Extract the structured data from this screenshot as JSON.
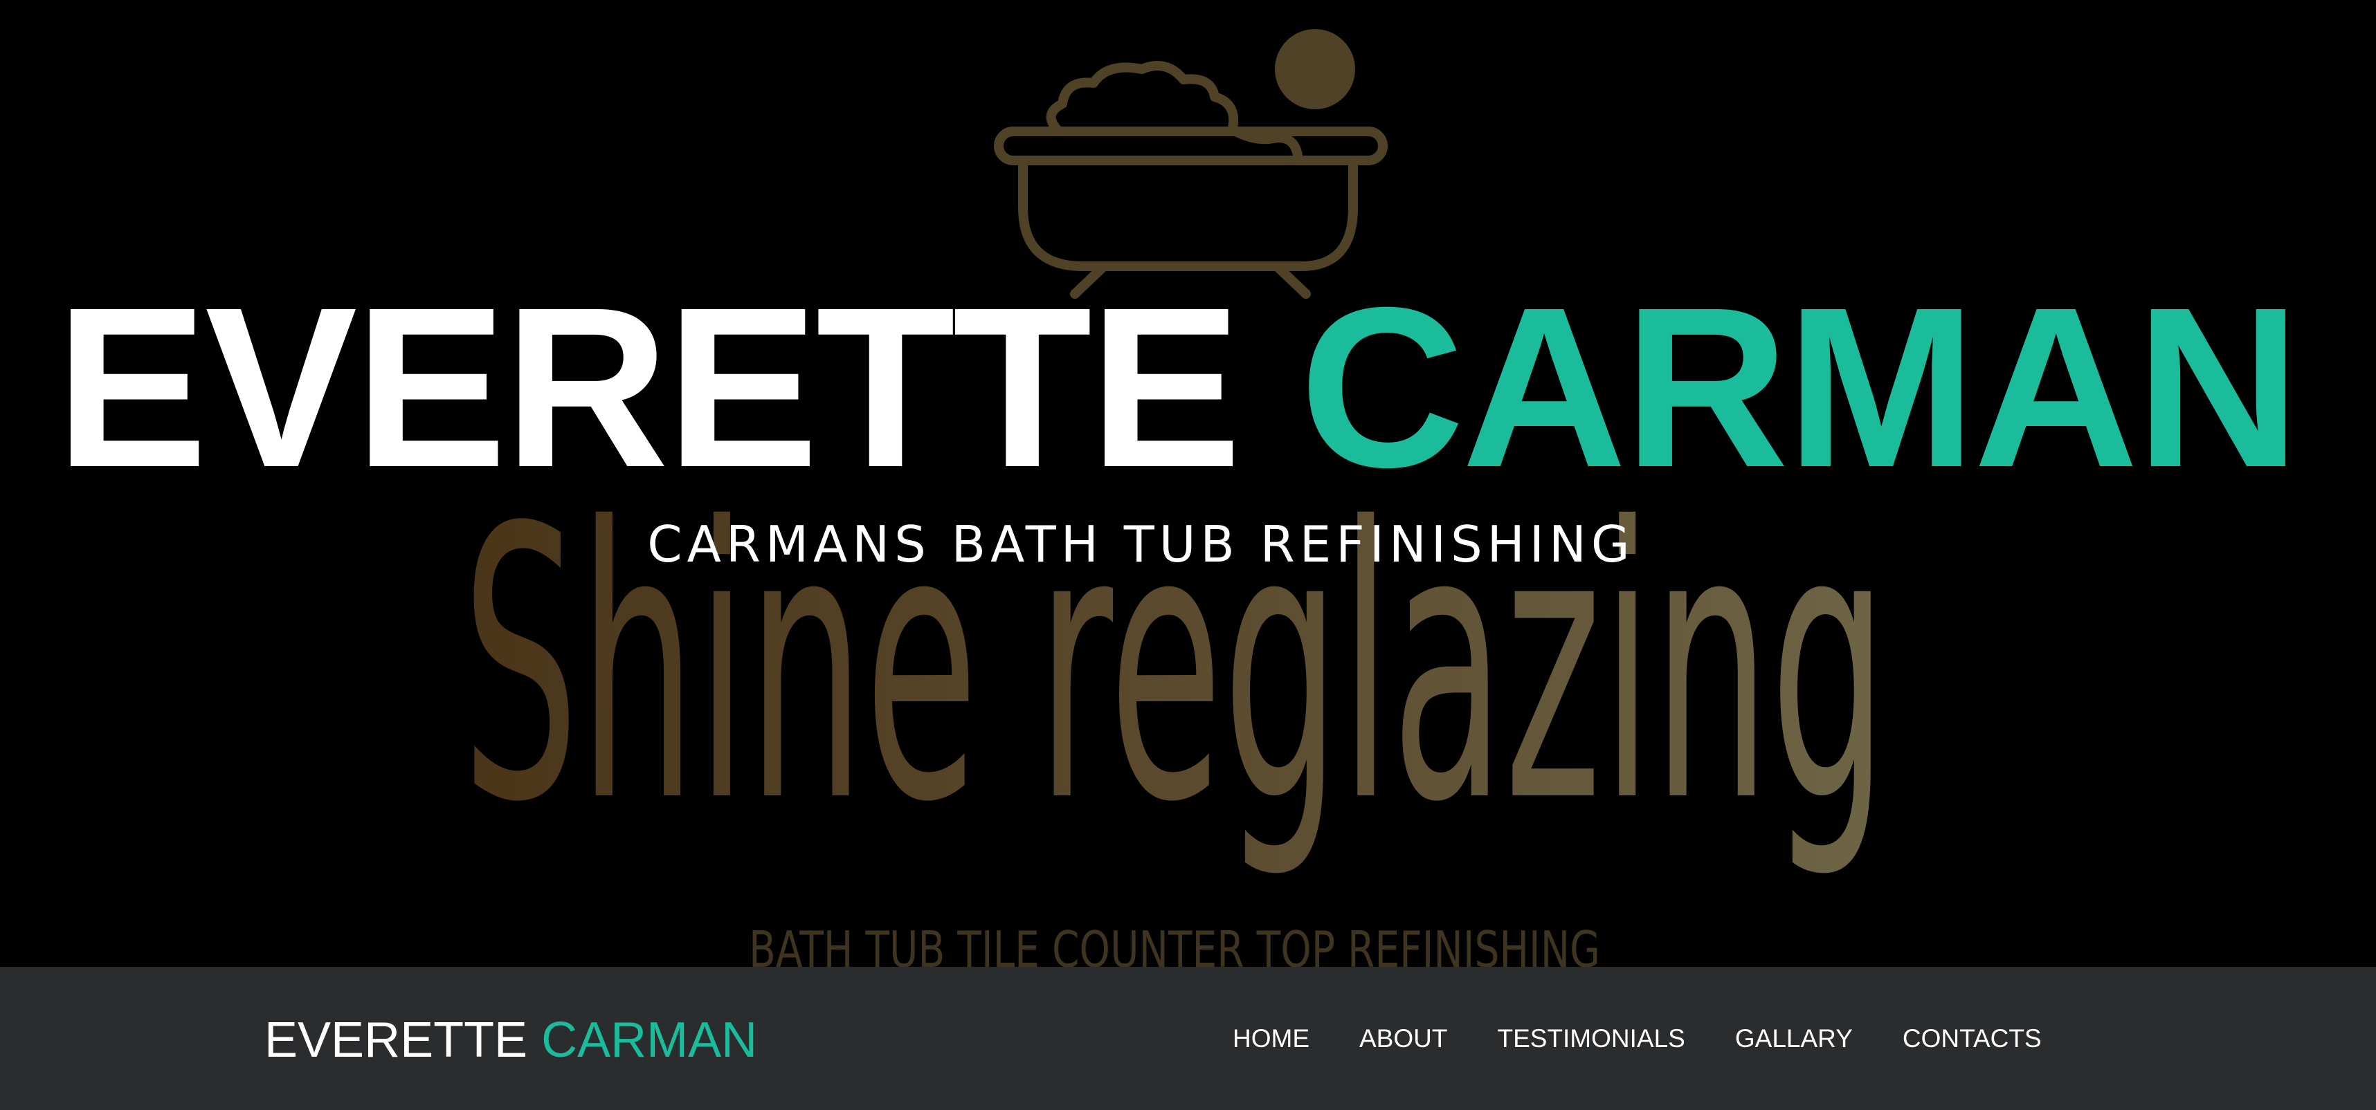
{
  "hero": {
    "title_first": "EVERETTE",
    "title_last": "CARMAN",
    "subtitle": "CARMANS BATH TUB REFINISHING",
    "background_logo": {
      "icon": "bathtub-icon",
      "wordmark": "Shine reglazing",
      "tagline": "BATH TUB TILE COUNTER TOP REFINISHING"
    }
  },
  "navbar": {
    "brand_first": "EVERETTE",
    "brand_last": "CARMAN",
    "items": [
      {
        "label": "HOME"
      },
      {
        "label": "ABOUT"
      },
      {
        "label": "TESTIMONIALS"
      },
      {
        "label": "GALLARY"
      },
      {
        "label": "CONTACTS"
      }
    ]
  },
  "colors": {
    "accent": "#1abc9c",
    "navbar_bg": "#2b2c2e",
    "hero_bg": "#000000",
    "logo_gold": "#6b5a3a"
  }
}
